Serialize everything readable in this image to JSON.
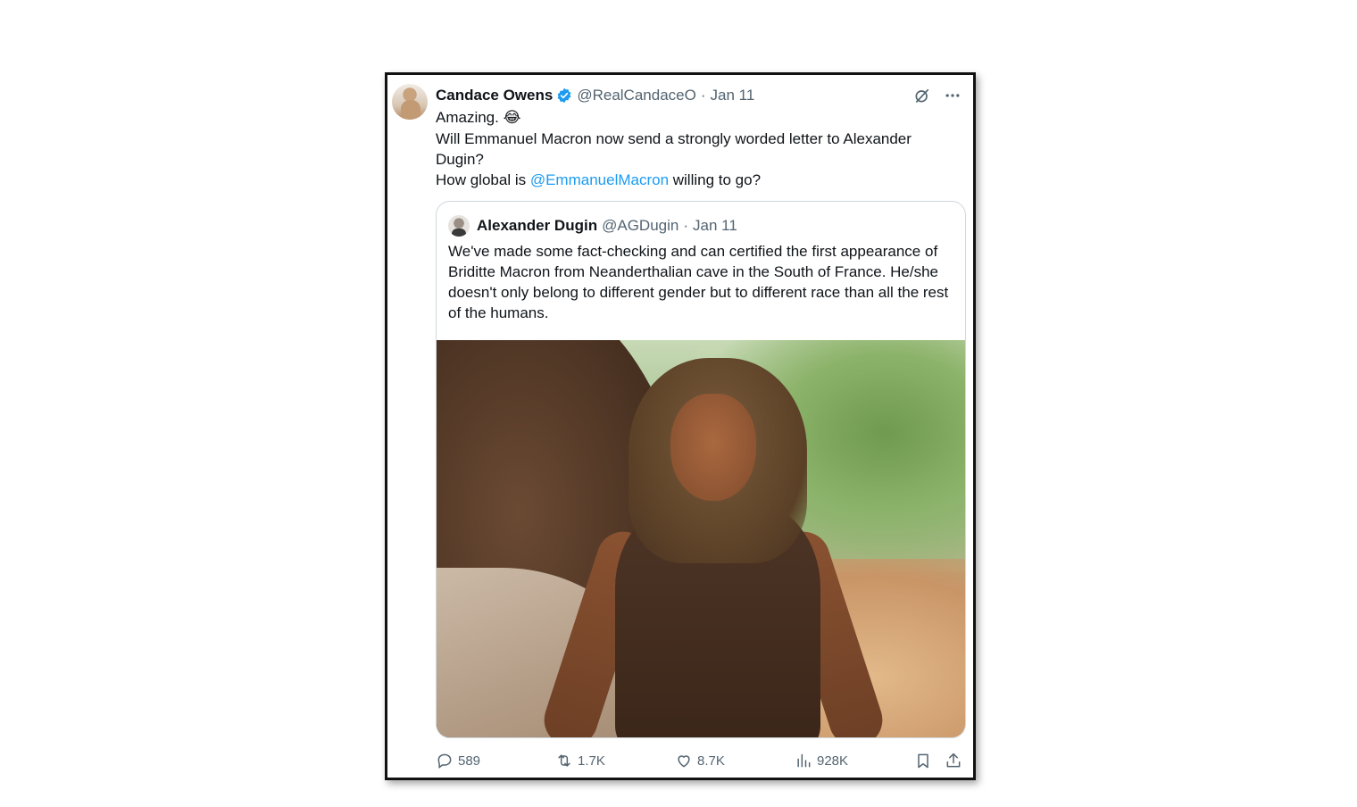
{
  "tweet": {
    "author_name": "Candace Owens",
    "author_handle": "@RealCandaceO",
    "separator": "·",
    "date": "Jan 11",
    "line1": "Amazing.",
    "line1_emoji": "😂",
    "line2": "Will Emmanuel Macron now send a strongly worded letter to Alexander Dugin?",
    "line3_prefix": "How global is ",
    "line3_mention": "@EmmanuelMacron",
    "line3_suffix": " willing to go?"
  },
  "quote": {
    "author_name": "Alexander Dugin",
    "author_handle": "@AGDugin",
    "separator": "·",
    "date": "Jan 11",
    "text": "We've made some fact-checking and can certified the first appearance of Briditte Macron from Neanderthalian cave in the South of France. He/she doesn't only belong to different gender but to different race than all the rest of the humans."
  },
  "actions": {
    "replies": "589",
    "reposts": "1.7K",
    "likes": "8.7K",
    "views": "928K"
  },
  "colors": {
    "accent": "#1d9bf0",
    "muted": "#536471",
    "verified": "#1d9bf0"
  },
  "icons": [
    "grok-icon",
    "more-icon",
    "reply-icon",
    "repost-icon",
    "like-icon",
    "views-icon",
    "bookmark-icon",
    "share-icon",
    "verified-badge-icon"
  ]
}
